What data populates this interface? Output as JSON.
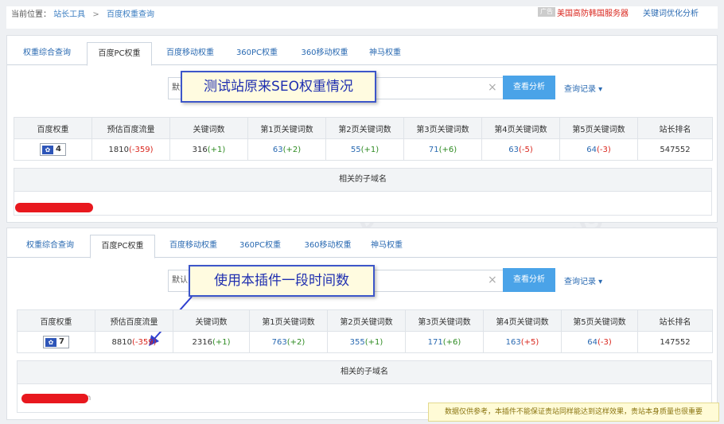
{
  "breadcrumb": {
    "prefix": "当前位置：",
    "item1": "站长工具",
    "separator": ">",
    "item2": "百度权重查询"
  },
  "header": {
    "ad_tag": "广告",
    "ad_link": "美国高防韩国服务器",
    "keyword_link": "关键词优化分析"
  },
  "tabs": [
    "权重综合查询",
    "百度PC权重",
    "百度移动权重",
    "360PC权重",
    "360移动权重",
    "神马权重"
  ],
  "search": {
    "prefix": "默认",
    "clear": "×",
    "button": "查看分析",
    "history": "查询记录 ▾"
  },
  "table_headers": [
    "百度权重",
    "预估百度流量",
    "关键词数",
    "第1页关键词数",
    "第2页关键词数",
    "第3页关键词数",
    "第4页关键词数",
    "第5页关键词数",
    "站长排名"
  ],
  "panel1": {
    "callout": "测试站原来SEO权重情况",
    "row": {
      "weight": "4",
      "traffic": "1810",
      "traffic_delta": "(-359)",
      "keywords": "316",
      "keywords_delta": "(+1)",
      "p1": "63",
      "p1_delta": "(+2)",
      "p2": "55",
      "p2_delta": "(+1)",
      "p3": "71",
      "p3_delta": "(+6)",
      "p4": "63",
      "p4_delta": "(-5)",
      "p5": "64",
      "p5_delta": "(-3)",
      "rank": "547552"
    },
    "subdomain_header": "相关的子域名"
  },
  "panel2": {
    "callout": "使用本插件一段时间数",
    "row": {
      "weight": "7",
      "traffic": "8810",
      "traffic_delta": "(-359)",
      "keywords": "2316",
      "keywords_delta": "(+1)",
      "p1": "763",
      "p1_delta": "(+2)",
      "p2": "355",
      "p2_delta": "(+1)",
      "p3": "171",
      "p3_delta": "(+6)",
      "p4": "163",
      "p4_delta": "(+5)",
      "p5": "64",
      "p5_delta": "(-3)",
      "rank": "147552"
    },
    "subdomain_header": "相关的子域名",
    "subdomain_partial": "com"
  },
  "notice": "数据仅供参考，本插件不能保证贵站同样能达到这样效果，贵站本身质量也很重要",
  "colors": {
    "link": "#2a6ab2",
    "accent_button": "#4aa3e8",
    "positive": "#2e8b22",
    "negative": "#d9251c",
    "callout_border": "#3d56c9"
  }
}
